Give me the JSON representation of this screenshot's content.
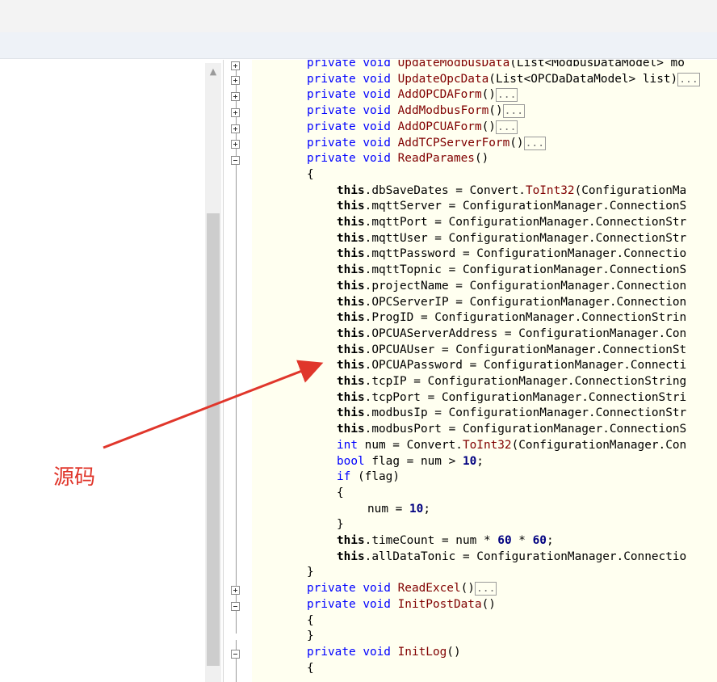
{
  "annotation": {
    "label": "源码"
  },
  "code_lines": [
    {
      "parts": [
        [
          "kw",
          "private "
        ],
        [
          "kw",
          "void "
        ],
        [
          "fn",
          "UpdateModbusData"
        ],
        [
          "t",
          "(List<ModbusDataModel> mo"
        ]
      ]
    },
    {
      "parts": [
        [
          "kw",
          "private "
        ],
        [
          "kw",
          "void "
        ],
        [
          "fn",
          "UpdateOpcData"
        ],
        [
          "t",
          "(List<OPCDaDataModel> list)"
        ],
        [
          "c",
          "..."
        ]
      ]
    },
    {
      "parts": [
        [
          "kw",
          "private "
        ],
        [
          "kw",
          "void "
        ],
        [
          "fn",
          "AddOPCDAForm"
        ],
        [
          "t",
          "()"
        ],
        [
          "c",
          "..."
        ]
      ]
    },
    {
      "parts": [
        [
          "kw",
          "private "
        ],
        [
          "kw",
          "void "
        ],
        [
          "fn",
          "AddModbusForm"
        ],
        [
          "t",
          "()"
        ],
        [
          "c",
          "..."
        ]
      ]
    },
    {
      "parts": [
        [
          "kw",
          "private "
        ],
        [
          "kw",
          "void "
        ],
        [
          "fn",
          "AddOPCUAForm"
        ],
        [
          "t",
          "()"
        ],
        [
          "c",
          "..."
        ]
      ]
    },
    {
      "parts": [
        [
          "kw",
          "private "
        ],
        [
          "kw",
          "void "
        ],
        [
          "fn",
          "AddTCPServerForm"
        ],
        [
          "t",
          "()"
        ],
        [
          "c",
          "..."
        ]
      ]
    },
    {
      "parts": [
        [
          "kw",
          "private "
        ],
        [
          "kw",
          "void "
        ],
        [
          "fn",
          "ReadParames"
        ],
        [
          "t",
          "()"
        ]
      ]
    },
    {
      "parts": [
        [
          "t",
          "{"
        ]
      ]
    },
    {
      "parts": [
        [
          "th",
          "this"
        ],
        [
          "t",
          ".dbSaveDates = Convert."
        ],
        [
          "fn",
          "ToInt32"
        ],
        [
          "t",
          "(ConfigurationMa"
        ]
      ]
    },
    {
      "parts": [
        [
          "th",
          "this"
        ],
        [
          "t",
          ".mqttServer = ConfigurationManager.ConnectionS"
        ]
      ]
    },
    {
      "parts": [
        [
          "th",
          "this"
        ],
        [
          "t",
          ".mqttPort = ConfigurationManager.ConnectionStr"
        ]
      ]
    },
    {
      "parts": [
        [
          "th",
          "this"
        ],
        [
          "t",
          ".mqttUser = ConfigurationManager.ConnectionStr"
        ]
      ]
    },
    {
      "parts": [
        [
          "th",
          "this"
        ],
        [
          "t",
          ".mqttPassword = ConfigurationManager.Connectio"
        ]
      ]
    },
    {
      "parts": [
        [
          "th",
          "this"
        ],
        [
          "t",
          ".mqttTopnic = ConfigurationManager.ConnectionS"
        ]
      ]
    },
    {
      "parts": [
        [
          "th",
          "this"
        ],
        [
          "t",
          ".projectName = ConfigurationManager.Connection"
        ]
      ]
    },
    {
      "parts": [
        [
          "th",
          "this"
        ],
        [
          "t",
          ".OPCServerIP = ConfigurationManager.Connection"
        ]
      ]
    },
    {
      "parts": [
        [
          "th",
          "this"
        ],
        [
          "t",
          ".ProgID = ConfigurationManager.ConnectionStrin"
        ]
      ]
    },
    {
      "parts": [
        [
          "th",
          "this"
        ],
        [
          "t",
          ".OPCUAServerAddress = ConfigurationManager.Con"
        ]
      ]
    },
    {
      "parts": [
        [
          "th",
          "this"
        ],
        [
          "t",
          ".OPCUAUser = ConfigurationManager.ConnectionSt"
        ]
      ]
    },
    {
      "parts": [
        [
          "th",
          "this"
        ],
        [
          "t",
          ".OPCUAPassword = ConfigurationManager.Connecti"
        ]
      ]
    },
    {
      "parts": [
        [
          "th",
          "this"
        ],
        [
          "t",
          ".tcpIP = ConfigurationManager.ConnectionString"
        ]
      ]
    },
    {
      "parts": [
        [
          "th",
          "this"
        ],
        [
          "t",
          ".tcpPort = ConfigurationManager.ConnectionStri"
        ]
      ]
    },
    {
      "parts": [
        [
          "th",
          "this"
        ],
        [
          "t",
          ".modbusIp = ConfigurationManager.ConnectionStr"
        ]
      ]
    },
    {
      "parts": [
        [
          "th",
          "this"
        ],
        [
          "t",
          ".modbusPort = ConfigurationManager.ConnectionS"
        ]
      ]
    },
    {
      "parts": [
        [
          "kw",
          "int "
        ],
        [
          "t",
          "num = Convert."
        ],
        [
          "fn",
          "ToInt32"
        ],
        [
          "t",
          "(ConfigurationManager.Con"
        ]
      ]
    },
    {
      "parts": [
        [
          "kw",
          "bool "
        ],
        [
          "t",
          "flag = num > "
        ],
        [
          "n",
          "10"
        ],
        [
          "t",
          ";"
        ]
      ]
    },
    {
      "parts": [
        [
          "kw",
          "if "
        ],
        [
          "t",
          "(flag)"
        ]
      ]
    },
    {
      "parts": [
        [
          "t",
          "{"
        ]
      ]
    },
    {
      "parts": [
        [
          "t",
          "num = "
        ],
        [
          "n",
          "10"
        ],
        [
          "t",
          ";"
        ]
      ]
    },
    {
      "parts": [
        [
          "t",
          "}"
        ]
      ]
    },
    {
      "parts": [
        [
          "th",
          "this"
        ],
        [
          "t",
          ".timeCount = num * "
        ],
        [
          "n",
          "60"
        ],
        [
          "t",
          " * "
        ],
        [
          "n",
          "60"
        ],
        [
          "t",
          ";"
        ]
      ]
    },
    {
      "parts": [
        [
          "th",
          "this"
        ],
        [
          "t",
          ".allDataTonic = ConfigurationManager.Connectio"
        ]
      ]
    },
    {
      "parts": [
        [
          "t",
          "}"
        ]
      ]
    },
    {
      "parts": [
        [
          "kw",
          "private "
        ],
        [
          "kw",
          "void "
        ],
        [
          "fn",
          "ReadExcel"
        ],
        [
          "t",
          "()"
        ],
        [
          "c",
          "..."
        ]
      ]
    },
    {
      "parts": [
        [
          "kw",
          "private "
        ],
        [
          "kw",
          "void "
        ],
        [
          "fn",
          "InitPostData"
        ],
        [
          "t",
          "()"
        ]
      ]
    },
    {
      "parts": [
        [
          "t",
          "{"
        ]
      ]
    },
    {
      "parts": [
        [
          "t",
          "}"
        ]
      ]
    },
    {
      "parts": [
        [
          "kw",
          "private "
        ],
        [
          "kw",
          "void "
        ],
        [
          "fn",
          "InitLog"
        ],
        [
          "t",
          "()"
        ]
      ]
    },
    {
      "parts": [
        [
          "t",
          "{"
        ]
      ]
    }
  ]
}
